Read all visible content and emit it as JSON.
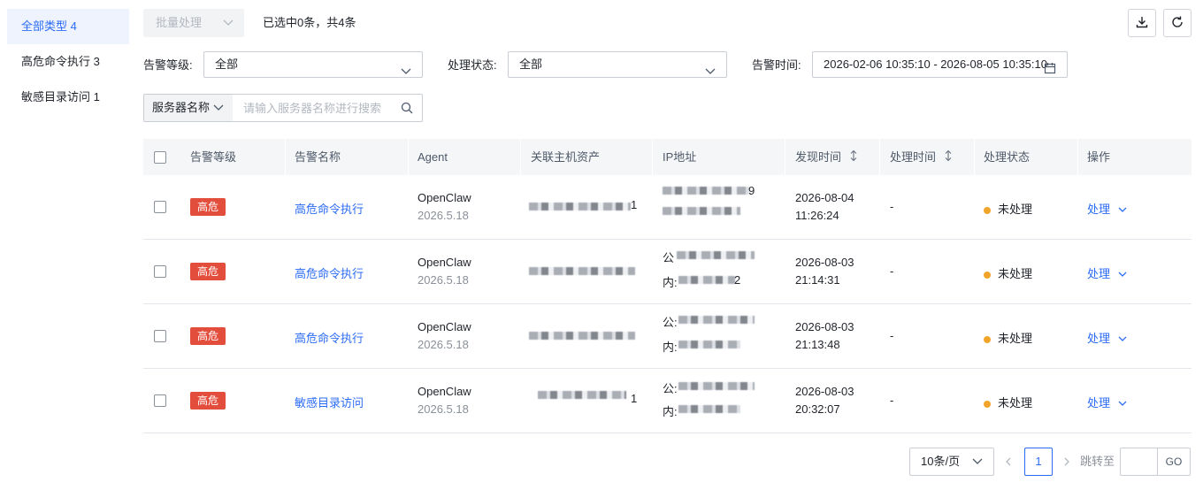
{
  "sidebar": {
    "items": [
      {
        "label": "全部类型 4",
        "active": true
      },
      {
        "label": "高危命令执行 3",
        "active": false
      },
      {
        "label": "敏感目录访问 1",
        "active": false
      }
    ]
  },
  "toolbar": {
    "batch_label": "批量处理",
    "selection_info": "已选中0条，共4条",
    "download_icon": "download-icon",
    "refresh_icon": "refresh-icon"
  },
  "filters": {
    "level_label": "告警等级:",
    "level_value": "全部",
    "status_label": "处理状态:",
    "status_value": "全部",
    "time_label": "告警时间:",
    "time_value": "2026-02-06 10:35:10 - 2026-08-05 10:35:10"
  },
  "search": {
    "type_label": "服务器名称",
    "placeholder": "请输入服务器名称进行搜索"
  },
  "table": {
    "headers": {
      "level": "告警等级",
      "name": "告警名称",
      "agent": "Agent",
      "host": "关联主机资产",
      "ip": "IP地址",
      "found_time": "发现时间",
      "handle_time": "处理时间",
      "status": "处理状态",
      "action": "操作"
    },
    "rows": [
      {
        "level": "高危",
        "name": "高危命令执行",
        "agent": "OpenClaw",
        "agent_version": "2026.5.18",
        "host_tail": "1",
        "ip_line1": "",
        "ip_line2": "",
        "ip_tail1": "9",
        "ip_tail2": "",
        "found_date": "2026-08-04",
        "found_time": "11:26:24",
        "handle_time": "-",
        "status": "未处理",
        "action": "处理"
      },
      {
        "level": "高危",
        "name": "高危命令执行",
        "agent": "OpenClaw",
        "agent_version": "2026.5.18",
        "host_tail": "",
        "ip_line1": "公",
        "ip_line2": "内:",
        "ip_tail1": "",
        "ip_tail2": "2",
        "found_date": "2026-08-03",
        "found_time": "21:14:31",
        "handle_time": "-",
        "status": "未处理",
        "action": "处理"
      },
      {
        "level": "高危",
        "name": "高危命令执行",
        "agent": "OpenClaw",
        "agent_version": "2026.5.18",
        "host_tail": "",
        "ip_line1": "公:",
        "ip_line2": "内:",
        "ip_tail1": "",
        "ip_tail2": "",
        "found_date": "2026-08-03",
        "found_time": "21:13:48",
        "handle_time": "-",
        "status": "未处理",
        "action": "处理"
      },
      {
        "level": "高危",
        "name": "敏感目录访问",
        "agent": "OpenClaw",
        "agent_version": "2026.5.18",
        "host_tail": "1",
        "ip_line1": "公:",
        "ip_line2": "内:",
        "ip_tail1": "",
        "ip_tail2": "",
        "found_date": "2026-08-03",
        "found_time": "20:32:07",
        "handle_time": "-",
        "status": "未处理",
        "action": "处理"
      }
    ]
  },
  "pagination": {
    "page_size": "10条/页",
    "current_page": "1",
    "jump_label": "跳转至",
    "go_label": "GO"
  },
  "colors": {
    "accent": "#2b6cf6",
    "danger": "#e34d3c",
    "pending": "#f0a52a"
  }
}
